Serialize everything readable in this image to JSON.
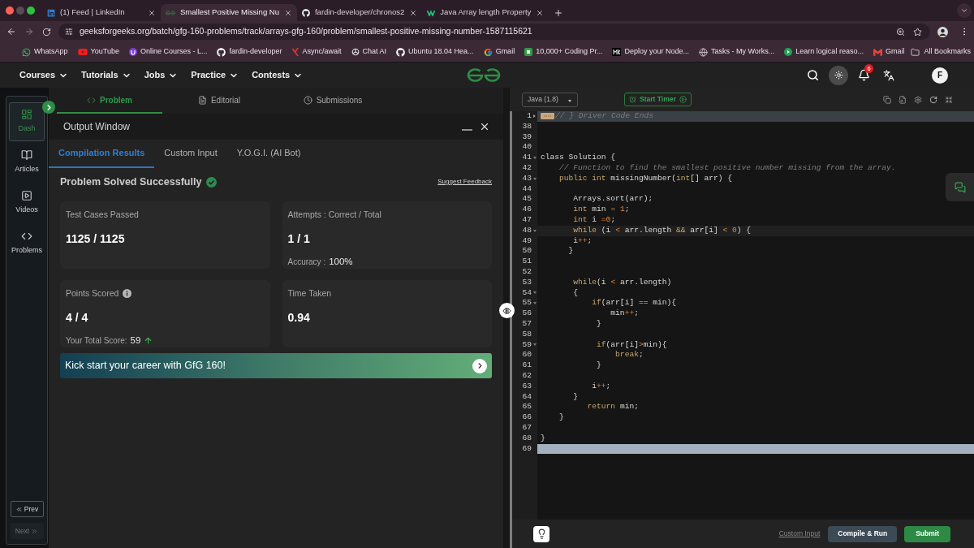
{
  "browser": {
    "tabs": [
      {
        "title": "(1) Feed | LinkedIn",
        "selected": false
      },
      {
        "title": "Smallest Positive Missing Nu",
        "selected": true
      },
      {
        "title": "fardin-developer/chronos2",
        "selected": false
      },
      {
        "title": "Java Array length Property",
        "selected": false
      }
    ],
    "url": "geeksforgeeks.org/batch/gfg-160-problems/track/arrays-gfg-160/problem/smallest-positive-missing-number-1587115621",
    "bookmarks": [
      "WhatsApp",
      "YouTube",
      "Online Courses - L...",
      "fardin-developer",
      "Async/await",
      "Chat AI",
      "Ubuntu 18.04 Hea...",
      "Gmail",
      "10,000+ Coding Pr...",
      "Deploy your Node...",
      "Tasks - My Works...",
      "Learn logical reaso...",
      "Gmail"
    ],
    "all_bookmarks": "All Bookmarks"
  },
  "site_nav": {
    "items": [
      "Courses",
      "Tutorials",
      "Jobs",
      "Practice",
      "Contests"
    ],
    "notification_count": "6",
    "avatar_initial": "F"
  },
  "sidebar": {
    "items": [
      {
        "label": "Dash",
        "selected": true
      },
      {
        "label": "Articles",
        "selected": false
      },
      {
        "label": "Videos",
        "selected": false
      },
      {
        "label": "Problems",
        "selected": false
      }
    ],
    "prev": {
      "label": "Prev",
      "disabled": false
    },
    "next": {
      "label": "Next",
      "disabled": true
    }
  },
  "problem_tabs": [
    {
      "label": "Problem",
      "selected": true
    },
    {
      "label": "Editorial",
      "selected": false
    },
    {
      "label": "Submissions",
      "selected": false
    }
  ],
  "output_window": {
    "title": "Output Window",
    "tabs": [
      {
        "label": "Compilation Results",
        "selected": true
      },
      {
        "label": "Custom Input",
        "selected": false
      },
      {
        "label": "Y.O.G.I. (AI Bot)",
        "selected": false
      }
    ],
    "status": "Problem Solved Successfully",
    "feedback_link": "Suggest Feedback",
    "cards": [
      {
        "title": "Test Cases Passed",
        "value": "1125 / 1125"
      },
      {
        "title": "Attempts : Correct / Total",
        "value": "1 / 1",
        "note_label": "Accuracy :",
        "note_value": "100%"
      },
      {
        "title": "Points Scored",
        "info": true,
        "value": "4 / 4",
        "note_label": "Your Total Score:",
        "note_value": "59",
        "rising": true
      },
      {
        "title": "Time Taken",
        "value": "0.94"
      }
    ],
    "banner": "Kick start your career with GfG 160!"
  },
  "editor": {
    "language": "Java (1.8)",
    "timer_button": "Start Timer",
    "lines": [
      {
        "number": "1",
        "folded": true,
        "tokens": [
          {
            "text": "// } Driver Code Ends",
            "kind": "comment"
          }
        ]
      },
      {
        "number": "38"
      },
      {
        "number": "39"
      },
      {
        "number": "40"
      },
      {
        "number": "41",
        "foldable": true,
        "tokens": [
          {
            "text": "class Solution {",
            "kind": "plain"
          }
        ]
      },
      {
        "number": "42",
        "tokens": [
          {
            "text": "    // Function to find the smallest positive number missing from the array.",
            "kind": "comment"
          }
        ]
      },
      {
        "number": "43",
        "foldable": true,
        "tokens": [
          {
            "text": "    public int",
            "kind": "keyword"
          },
          {
            "text": " missingNumber(",
            "kind": "plain"
          },
          {
            "text": "int",
            "kind": "keyword"
          },
          {
            "text": "[] arr) {",
            "kind": "plain"
          }
        ]
      },
      {
        "number": "44"
      },
      {
        "number": "45",
        "tokens": [
          {
            "text": "       Arrays.sort(arr);",
            "kind": "plain"
          }
        ]
      },
      {
        "number": "46",
        "tokens": [
          {
            "text": "       int",
            "kind": "keyword"
          },
          {
            "text": " min ",
            "kind": "plain"
          },
          {
            "text": "= 1",
            "kind": "number"
          },
          {
            "text": ";",
            "kind": "plain"
          }
        ]
      },
      {
        "number": "47",
        "tokens": [
          {
            "text": "       int",
            "kind": "keyword"
          },
          {
            "text": " i ",
            "kind": "plain"
          },
          {
            "text": "=0",
            "kind": "number"
          },
          {
            "text": ";",
            "kind": "plain"
          }
        ]
      },
      {
        "number": "48",
        "foldable": true,
        "current": true,
        "tokens": [
          {
            "text": "       while",
            "kind": "keyword"
          },
          {
            "text": " (i ",
            "kind": "plain"
          },
          {
            "text": "<",
            "kind": "operator"
          },
          {
            "text": " arr.length ",
            "kind": "plain"
          },
          {
            "text": "&&",
            "kind": "keyword"
          },
          {
            "text": " arr[i] ",
            "kind": "plain"
          },
          {
            "text": "< 0",
            "kind": "operator"
          },
          {
            "text": ") {",
            "kind": "plain"
          }
        ]
      },
      {
        "number": "49",
        "tokens": [
          {
            "text": "       i",
            "kind": "plain"
          },
          {
            "text": "++",
            "kind": "operator"
          },
          {
            "text": ";",
            "kind": "plain"
          }
        ]
      },
      {
        "number": "50",
        "tokens": [
          {
            "text": "      }",
            "kind": "plain"
          }
        ]
      },
      {
        "number": "51"
      },
      {
        "number": "52"
      },
      {
        "number": "53",
        "tokens": [
          {
            "text": "       while",
            "kind": "keyword"
          },
          {
            "text": "(i ",
            "kind": "plain"
          },
          {
            "text": "<",
            "kind": "operator"
          },
          {
            "text": " arr.length)",
            "kind": "plain"
          }
        ]
      },
      {
        "number": "54",
        "foldable": true,
        "tokens": [
          {
            "text": "       {",
            "kind": "plain"
          }
        ]
      },
      {
        "number": "55",
        "foldable": true,
        "tokens": [
          {
            "text": "           if",
            "kind": "keyword"
          },
          {
            "text": "(arr[i] == min){",
            "kind": "plain"
          }
        ]
      },
      {
        "number": "56",
        "tokens": [
          {
            "text": "               min",
            "kind": "plain"
          },
          {
            "text": "++",
            "kind": "operator"
          },
          {
            "text": ";",
            "kind": "plain"
          }
        ]
      },
      {
        "number": "57",
        "tokens": [
          {
            "text": "            }",
            "kind": "plain"
          }
        ]
      },
      {
        "number": "58"
      },
      {
        "number": "59",
        "foldable": true,
        "tokens": [
          {
            "text": "            if",
            "kind": "keyword"
          },
          {
            "text": "(arr[i]",
            "kind": "plain"
          },
          {
            "text": ">",
            "kind": "operator"
          },
          {
            "text": "min){",
            "kind": "plain"
          }
        ]
      },
      {
        "number": "60",
        "tokens": [
          {
            "text": "                break",
            "kind": "keyword"
          },
          {
            "text": ";",
            "kind": "plain"
          }
        ]
      },
      {
        "number": "61",
        "tokens": [
          {
            "text": "            }",
            "kind": "plain"
          }
        ]
      },
      {
        "number": "62"
      },
      {
        "number": "63",
        "tokens": [
          {
            "text": "           i",
            "kind": "plain"
          },
          {
            "text": "++",
            "kind": "operator"
          },
          {
            "text": ";",
            "kind": "plain"
          }
        ]
      },
      {
        "number": "64",
        "tokens": [
          {
            "text": "       }",
            "kind": "plain"
          }
        ]
      },
      {
        "number": "65",
        "tokens": [
          {
            "text": "          return",
            "kind": "keyword"
          },
          {
            "text": " min;",
            "kind": "plain"
          }
        ]
      },
      {
        "number": "66",
        "tokens": [
          {
            "text": "    }",
            "kind": "plain"
          }
        ]
      },
      {
        "number": "67"
      },
      {
        "number": "68",
        "tokens": [
          {
            "text": "}",
            "kind": "plain"
          }
        ]
      },
      {
        "number": "69",
        "in_selection": true
      }
    ],
    "custom_input_link": "Custom Input",
    "run_button": "Compile & Run",
    "submit_button": "Submit"
  }
}
